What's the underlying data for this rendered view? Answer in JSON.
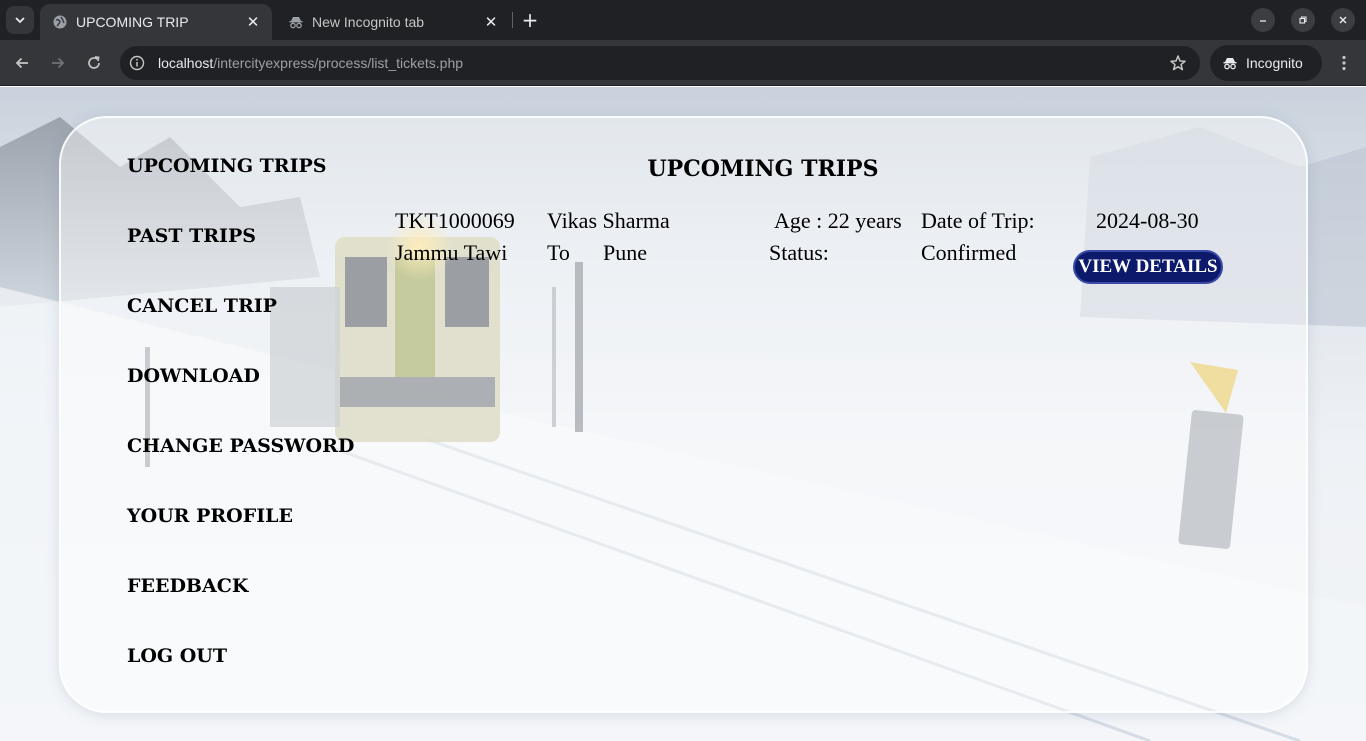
{
  "browser": {
    "tabs": [
      {
        "title": "UPCOMING TRIP",
        "icon": "globe-icon",
        "active": true
      },
      {
        "title": "New Incognito tab",
        "icon": "incognito-icon",
        "active": false
      }
    ],
    "url_host": "localhost",
    "url_path": "/intercityexpress/process/list_tickets.php",
    "incognito_label": "Incognito"
  },
  "sidebar": {
    "items": [
      {
        "label": "UPCOMING TRIPS"
      },
      {
        "label": "PAST TRIPS"
      },
      {
        "label": "CANCEL TRIP"
      },
      {
        "label": "DOWNLOAD"
      },
      {
        "label": "CHANGE PASSWORD"
      },
      {
        "label": "YOUR PROFILE"
      },
      {
        "label": "FEEDBACK"
      },
      {
        "label": "LOG OUT"
      }
    ]
  },
  "main": {
    "title": "UPCOMING TRIPS",
    "ticket": {
      "id": "TKT1000069",
      "passenger": "Vikas Sharma",
      "age": "Age : 22 years",
      "date_label": "Date of Trip:",
      "date": "2024-08-30",
      "from": "Jammu Tawi",
      "to_label": "To",
      "to": "Pune",
      "status_label": "Status:",
      "status": "Confirmed",
      "button_label": "VIEW DETAILS"
    }
  },
  "colors": {
    "button_bg": "#0d1a6b",
    "chrome_dark": "#202124",
    "chrome_tab": "#35363a"
  }
}
